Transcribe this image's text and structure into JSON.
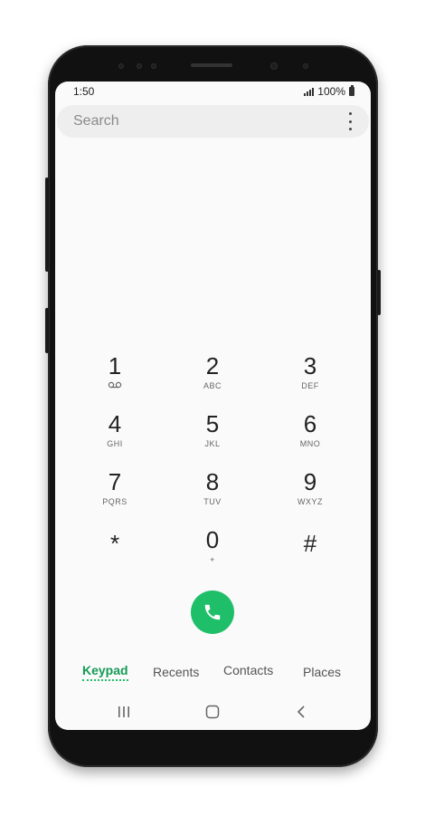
{
  "status_bar": {
    "time": "1:50",
    "battery": "100%"
  },
  "search": {
    "placeholder": "Search"
  },
  "keypad": [
    {
      "digit": "1",
      "letters": ""
    },
    {
      "digit": "2",
      "letters": "ABC"
    },
    {
      "digit": "3",
      "letters": "DEF"
    },
    {
      "digit": "4",
      "letters": "GHI"
    },
    {
      "digit": "5",
      "letters": "JKL"
    },
    {
      "digit": "6",
      "letters": "MNO"
    },
    {
      "digit": "7",
      "letters": "PQRS"
    },
    {
      "digit": "8",
      "letters": "TUV"
    },
    {
      "digit": "9",
      "letters": "WXYZ"
    },
    {
      "digit": "*",
      "letters": ""
    },
    {
      "digit": "0",
      "letters": "+"
    },
    {
      "digit": "#",
      "letters": ""
    }
  ],
  "tabs": [
    "Keypad",
    "Recents",
    "Contacts",
    "Places"
  ],
  "colors": {
    "accent": "#1fbf6a",
    "accent_text": "#159a56"
  },
  "icons": [
    "voicemail-icon",
    "phone-icon",
    "more-options-icon",
    "recent-apps-icon",
    "home-icon",
    "back-icon"
  ]
}
